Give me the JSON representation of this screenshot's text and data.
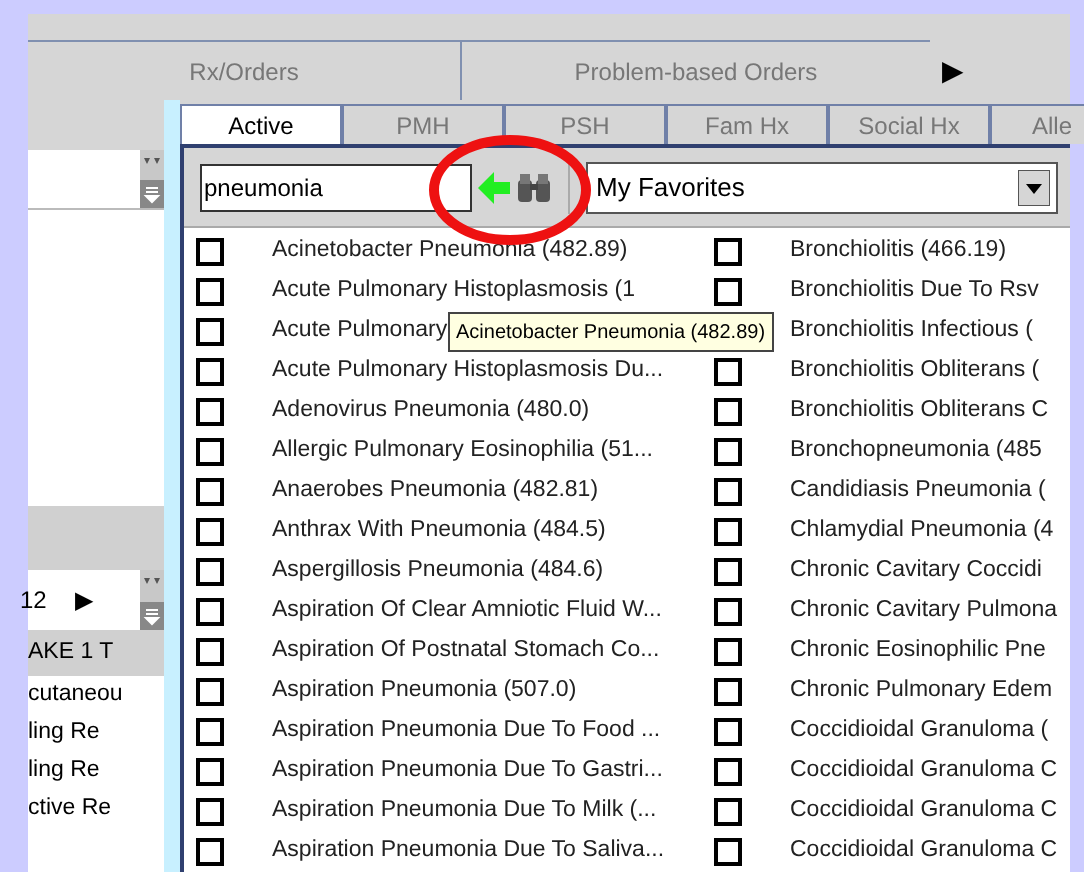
{
  "top_tabs": [
    {
      "label": "Rx/Orders",
      "selected": false
    },
    {
      "label": "Problem-based Orders",
      "selected": false
    }
  ],
  "top_tabs_more": "▶",
  "left_panel": {
    "pager_value": "12",
    "pager_arrow": "▶",
    "header": "AKE 1  T",
    "rows": [
      "cutaneou",
      "ling  Re",
      "ling  Re",
      "ctive  Re"
    ]
  },
  "tabs": [
    {
      "label": "Active",
      "selected": true
    },
    {
      "label": "PMH",
      "selected": false
    },
    {
      "label": "PSH",
      "selected": false
    },
    {
      "label": "Fam Hx",
      "selected": false
    },
    {
      "label": "Social Hx",
      "selected": false
    },
    {
      "label": "Alle",
      "selected": false
    }
  ],
  "search": {
    "value": "pneumonia"
  },
  "favorites": {
    "value": "My Favorites"
  },
  "columns": [
    [
      {
        "label": "Acinetobacter Pneumonia  (482.89)",
        "checked": false
      },
      {
        "label": "Acute Pulmonary Histoplasmosis  (1",
        "checked": false
      },
      {
        "label": "Acute Pulmonary",
        "checked": false
      },
      {
        "label": "Acute Pulmonary Histoplasmosis Du...",
        "checked": false
      },
      {
        "label": "Adenovirus Pneumonia  (480.0)",
        "checked": false
      },
      {
        "label": "Allergic Pulmonary Eosinophilia  (51...",
        "checked": false
      },
      {
        "label": "Anaerobes Pneumonia  (482.81)",
        "checked": false
      },
      {
        "label": "Anthrax With Pneumonia  (484.5)",
        "checked": false
      },
      {
        "label": "Aspergillosis Pneumonia  (484.6)",
        "checked": false
      },
      {
        "label": "Aspiration Of Clear Amniotic Fluid W...",
        "checked": false
      },
      {
        "label": "Aspiration Of Postnatal Stomach Co...",
        "checked": false
      },
      {
        "label": "Aspiration Pneumonia  (507.0)",
        "checked": false
      },
      {
        "label": "Aspiration Pneumonia Due To Food  ...",
        "checked": false
      },
      {
        "label": "Aspiration Pneumonia Due To Gastri...",
        "checked": false
      },
      {
        "label": "Aspiration Pneumonia Due To Milk  (...",
        "checked": false
      },
      {
        "label": "Aspiration Pneumonia Due To Saliva...",
        "checked": false
      }
    ],
    [
      {
        "label": "Bronchiolitis  (466.19)",
        "checked": false
      },
      {
        "label": "Bronchiolitis Due To Rsv",
        "checked": false
      },
      {
        "label": "Bronchiolitis Infectious  ("
      },
      {
        "label": "Bronchiolitis Obliterans  (",
        "checked": false
      },
      {
        "label": "Bronchiolitis Obliterans C",
        "checked": false
      },
      {
        "label": "Bronchopneumonia  (485",
        "checked": false
      },
      {
        "label": "Candidiasis Pneumonia  (",
        "checked": false
      },
      {
        "label": "Chlamydial Pneumonia  (4",
        "checked": false
      },
      {
        "label": "Chronic Cavitary Coccidi",
        "checked": false
      },
      {
        "label": "Chronic Cavitary Pulmona",
        "checked": false
      },
      {
        "label": "Chronic Eosinophilic Pne",
        "checked": false
      },
      {
        "label": "Chronic Pulmonary Edem",
        "checked": false
      },
      {
        "label": "Coccidioidal Granuloma  (",
        "checked": false
      },
      {
        "label": "Coccidioidal Granuloma C",
        "checked": false
      },
      {
        "label": "Coccidioidal Granuloma C",
        "checked": false
      },
      {
        "label": "Coccidioidal Granuloma C",
        "checked": false
      }
    ]
  ],
  "tooltip": {
    "text": "Acinetobacter Pneumonia  (482.89)"
  }
}
